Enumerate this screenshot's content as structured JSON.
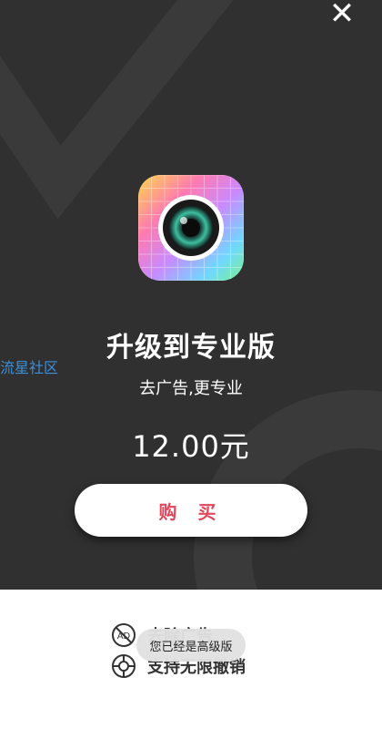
{
  "header": {
    "close_icon": "close-icon"
  },
  "app_icon": {
    "name": "camera-app-icon"
  },
  "title": "升级到专业版",
  "subtitle": "去广告,更专业",
  "price": "12.00元",
  "watermark": "流星社区",
  "buy_button": {
    "label": "购 买",
    "color": "#e0475c"
  },
  "features": [
    {
      "icon": "no-ads-icon",
      "label": "去除广告"
    },
    {
      "icon": "undo-icon",
      "label": "支持无限撤销"
    }
  ],
  "toast": "您已经是高级版",
  "colors": {
    "background": "#303030",
    "accent": "#e0475c",
    "watermark": "#3d8fd8"
  }
}
